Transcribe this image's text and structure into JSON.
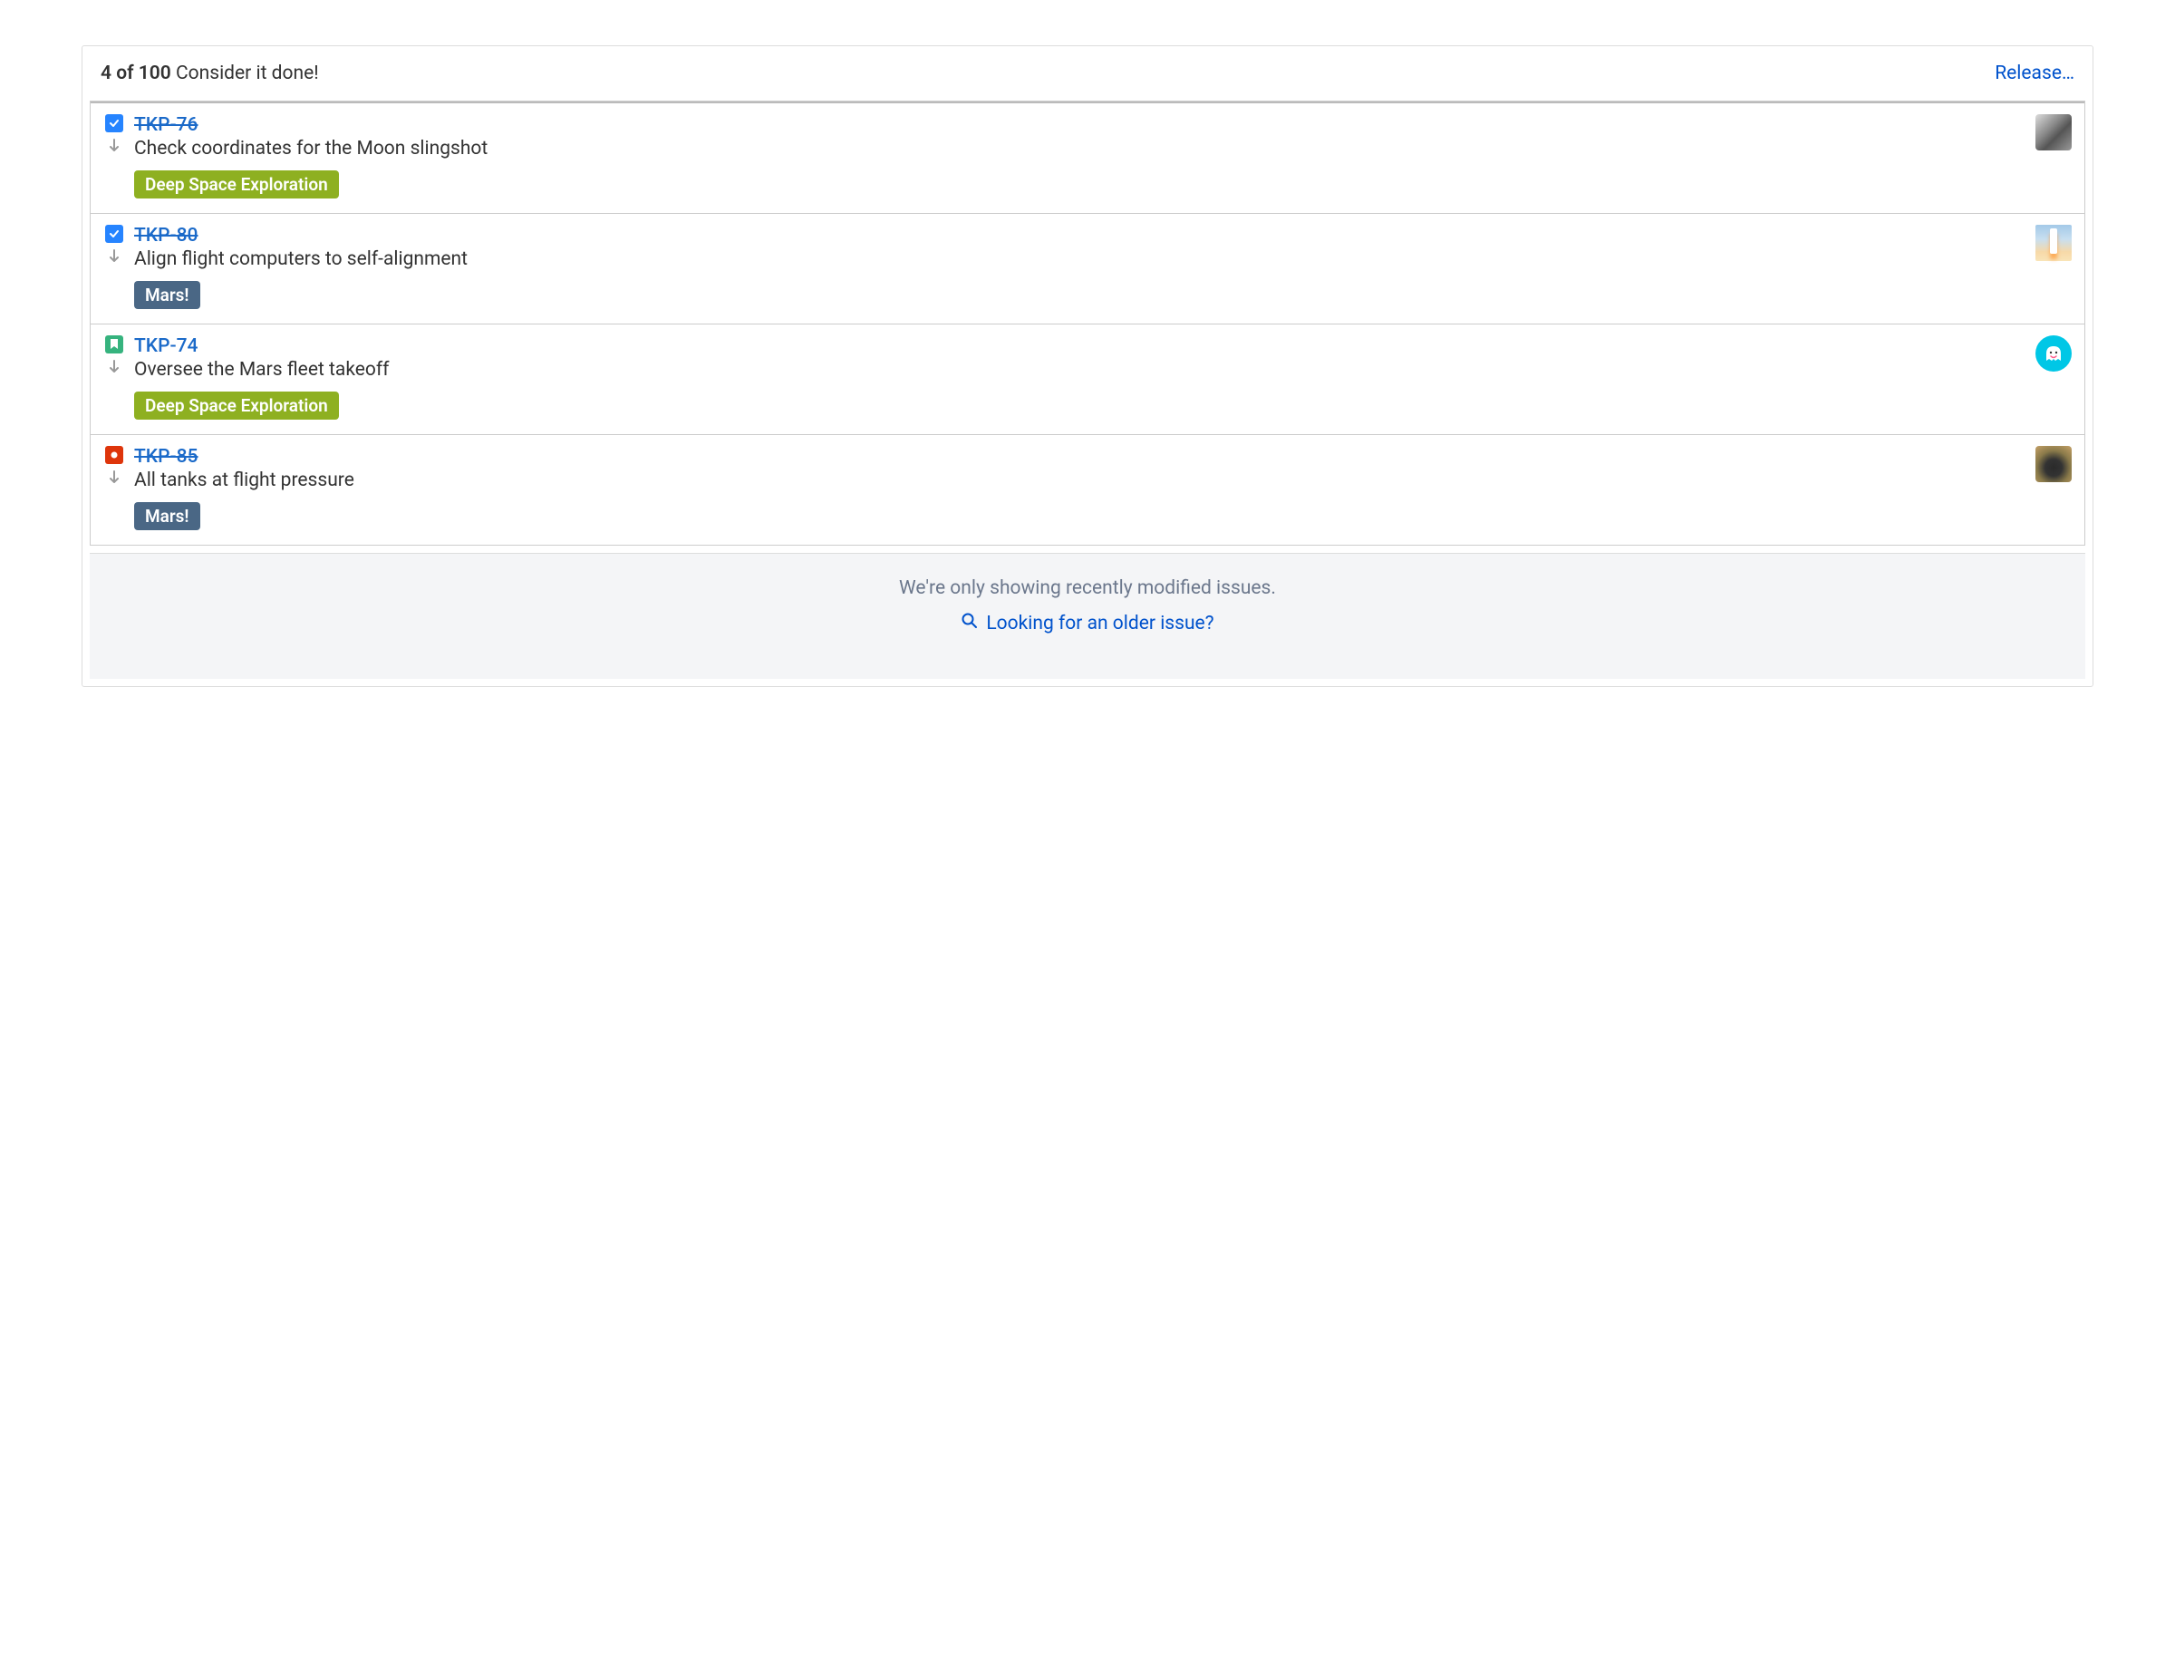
{
  "header": {
    "count_text": "4 of 100",
    "message": "Consider it done!",
    "release_label": "Release…"
  },
  "issues": [
    {
      "key": "TKP-76",
      "done": true,
      "type": "task",
      "priority": "low",
      "summary": "Check coordinates for the Moon slingshot",
      "tag": "Deep Space Exploration",
      "tag_color": "#8eb021",
      "avatar": "person-bw"
    },
    {
      "key": "TKP-80",
      "done": true,
      "type": "task",
      "priority": "low",
      "summary": "Align flight computers to self-alignment",
      "tag": "Mars!",
      "tag_color": "#4a6785",
      "avatar": "rocket"
    },
    {
      "key": "TKP-74",
      "done": false,
      "type": "story",
      "priority": "low",
      "summary": "Oversee the Mars fleet takeoff",
      "tag": "Deep Space Exploration",
      "tag_color": "#8eb021",
      "avatar": "ghost"
    },
    {
      "key": "TKP-85",
      "done": true,
      "type": "bug",
      "priority": "low",
      "summary": "All tanks at flight pressure",
      "tag": "Mars!",
      "tag_color": "#4a6785",
      "avatar": "sunset"
    }
  ],
  "footer": {
    "info_text": "We're only showing recently modified issues.",
    "link_text": "Looking for an older issue?"
  }
}
